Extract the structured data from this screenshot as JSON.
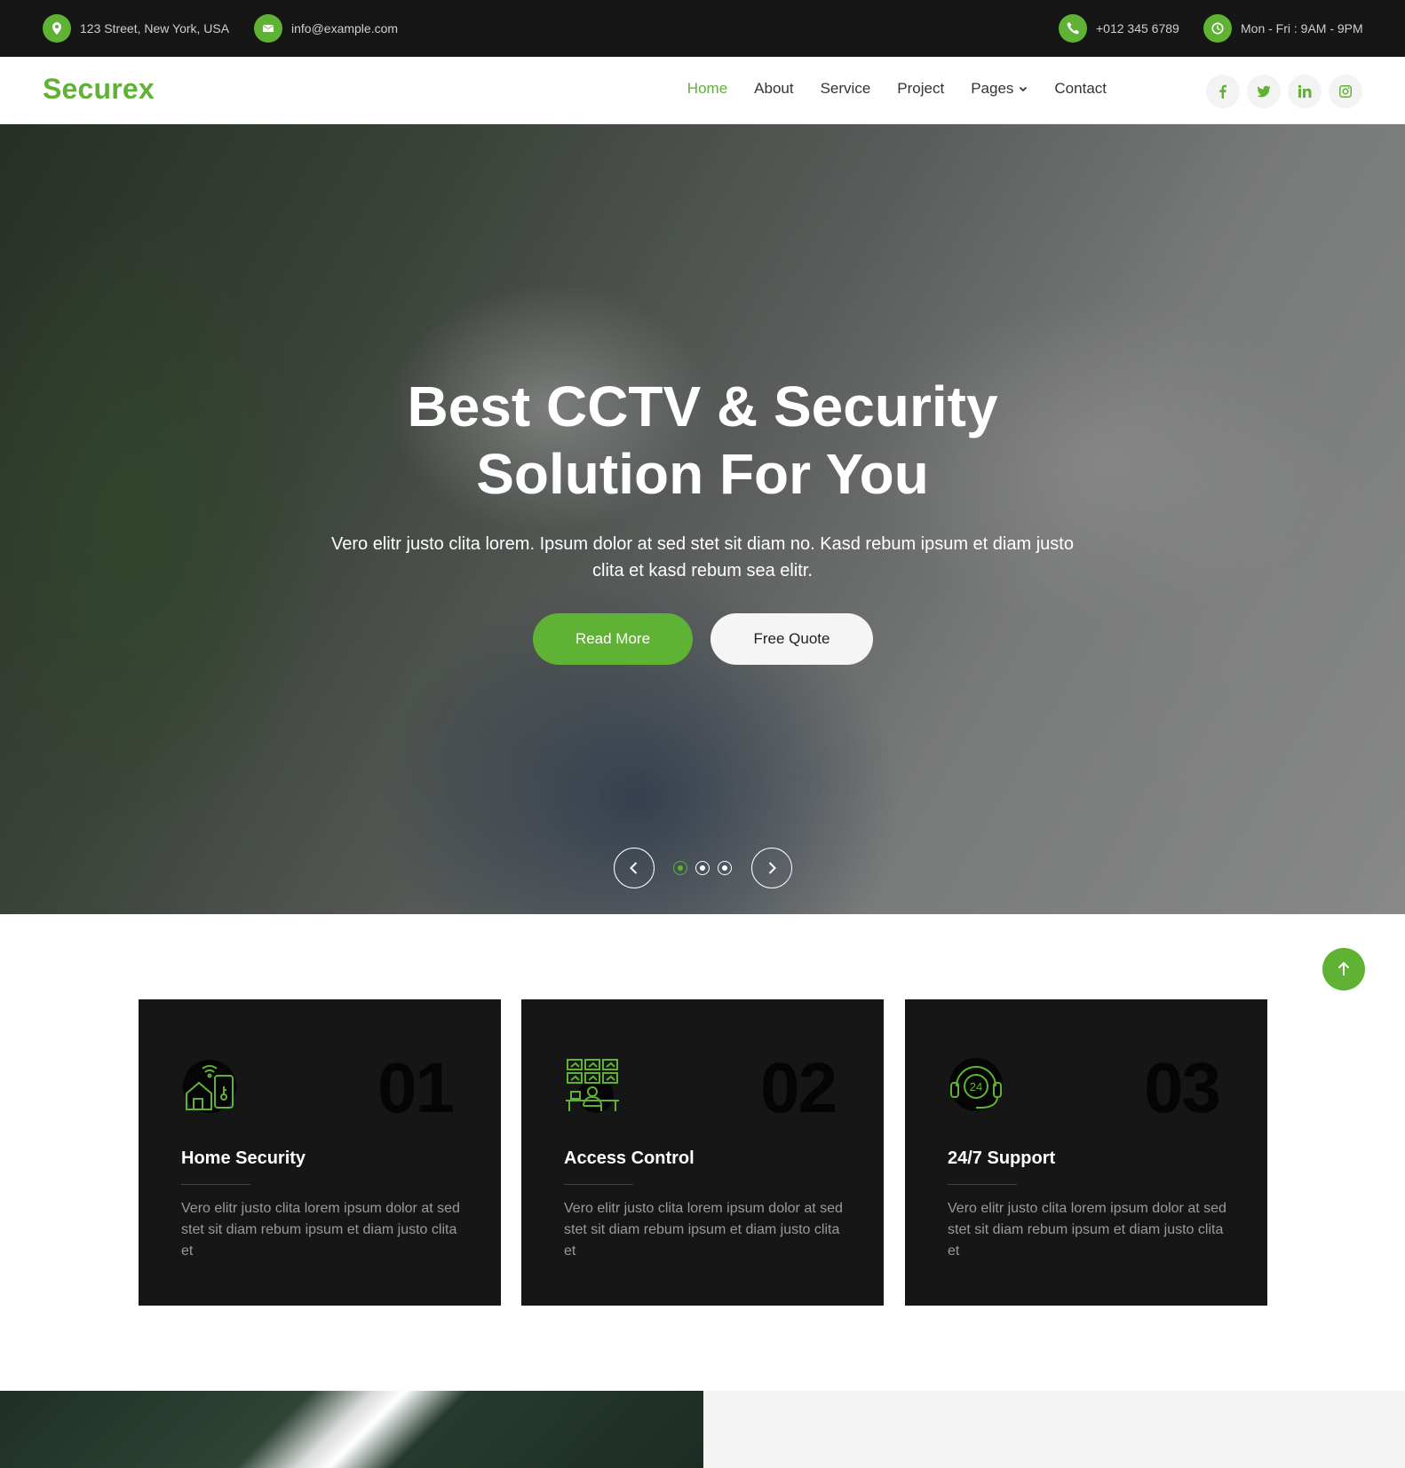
{
  "topbar": {
    "address": "123 Street, New York, USA",
    "email": "info@example.com",
    "phone": "+012 345 6789",
    "hours": "Mon - Fri : 9AM - 9PM"
  },
  "navbar": {
    "brand": "Securex",
    "items": [
      {
        "label": "Home"
      },
      {
        "label": "About"
      },
      {
        "label": "Service"
      },
      {
        "label": "Project"
      },
      {
        "label": "Pages"
      },
      {
        "label": "Contact"
      }
    ],
    "socials": [
      "facebook-icon",
      "twitter-icon",
      "linkedin-icon",
      "instagram-icon"
    ]
  },
  "hero": {
    "title_line1": "Best CCTV & Security",
    "title_line2": "Solution For You",
    "subtitle": "Vero elitr justo clita lorem. Ipsum dolor at sed stet sit diam no. Kasd rebum ipsum et diam justo clita et kasd rebum sea elitr.",
    "primary_button": "Read More",
    "secondary_button": "Free Quote",
    "active_slide": 1,
    "slide_count": 3
  },
  "features": [
    {
      "number": "01",
      "title": "Home Security",
      "text": "Vero elitr justo clita lorem ipsum dolor at sed stet sit diam rebum ipsum et diam justo clita et",
      "icon": "smart-home-icon"
    },
    {
      "number": "02",
      "title": "Access Control",
      "text": "Vero elitr justo clita lorem ipsum dolor at sed stet sit diam rebum ipsum et diam justo clita et",
      "icon": "cctv-monitoring-icon"
    },
    {
      "number": "03",
      "title": "24/7 Support",
      "text": "Vero elitr justo clita lorem ipsum dolor at sed stet sit diam rebum ipsum et diam justo clita et",
      "icon": "support-24-7-icon"
    }
  ],
  "colors": {
    "accent": "#5fb233",
    "dark": "#161616"
  }
}
